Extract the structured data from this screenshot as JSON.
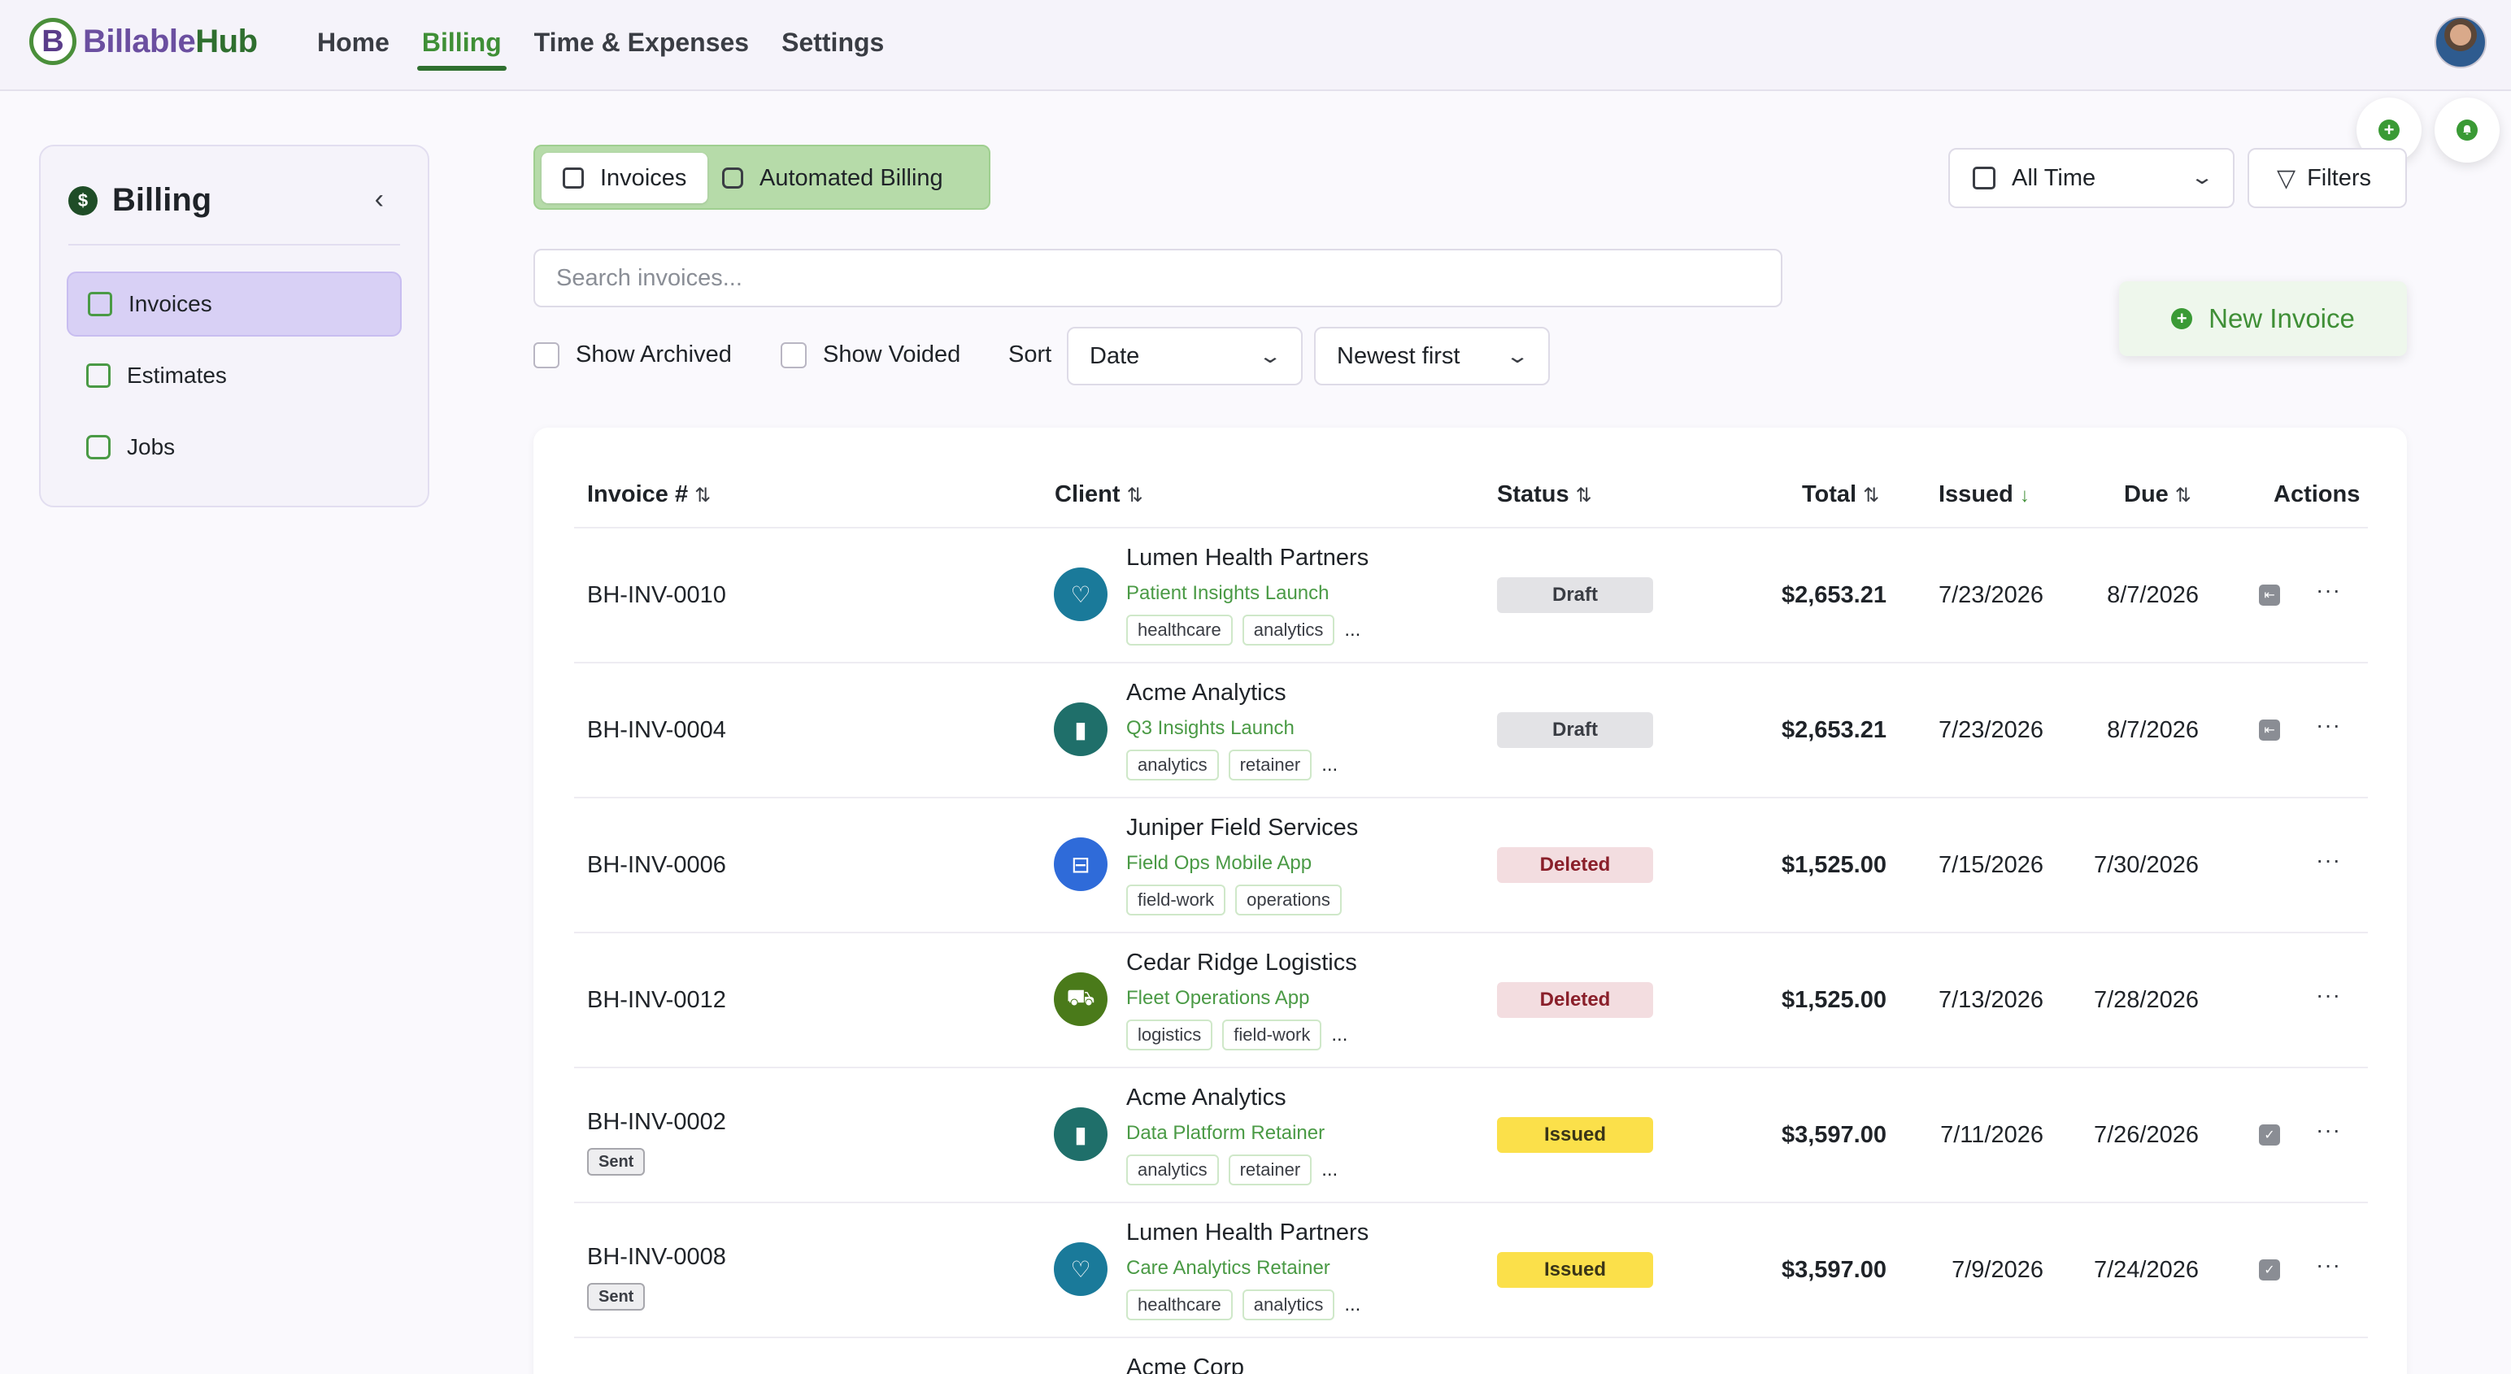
{
  "brand": {
    "mark": "B",
    "name_a": "Billable",
    "name_b": "Hub"
  },
  "nav": {
    "items": [
      "Home",
      "Billing",
      "Time & Expenses",
      "Settings"
    ],
    "active": "Billing"
  },
  "sidebar": {
    "title": "Billing",
    "coin": "$",
    "collapse": "‹",
    "items": [
      {
        "label": "Invoices",
        "icon": "invoice-icon",
        "active": true
      },
      {
        "label": "Estimates",
        "icon": "estimate-icon",
        "active": false
      },
      {
        "label": "Jobs",
        "icon": "briefcase-icon",
        "active": false
      }
    ]
  },
  "tabs": {
    "invoices": "Invoices",
    "automated": "Automated Billing"
  },
  "filters": {
    "range": "All Time",
    "filters_label": "Filters"
  },
  "new_invoice": {
    "label": "New Invoice",
    "plus": "+"
  },
  "search": {
    "placeholder": "Search invoices..."
  },
  "options": {
    "show_archived": "Show Archived",
    "show_voided": "Show Voided",
    "sort_label": "Sort",
    "sort_field": "Date",
    "sort_order": "Newest first"
  },
  "table": {
    "headers": {
      "invoice": "Invoice #",
      "client": "Client",
      "status": "Status",
      "total": "Total",
      "issued": "Issued",
      "due": "Due",
      "actions": "Actions"
    },
    "sort_icon": "⇅",
    "sort_desc_icon": "↓",
    "more": "···",
    "rows": [
      {
        "invoice": "BH-INV-0010",
        "badge": "",
        "client": "Lumen Health Partners",
        "project": "Patient Insights Launch",
        "tags": [
          "healthcare",
          "analytics"
        ],
        "more_tags": "...",
        "logo": "heart-icon",
        "logo_color": "#1a7a9a",
        "status": "Draft",
        "total": "$2,653.21",
        "issued": "7/23/2026",
        "due": "8/7/2026",
        "action": "send-icon"
      },
      {
        "invoice": "BH-INV-0004",
        "badge": "",
        "client": "Acme Analytics",
        "project": "Q3 Insights Launch",
        "tags": [
          "analytics",
          "retainer"
        ],
        "more_tags": "...",
        "logo": "bar-chart-icon",
        "logo_color": "#1f6f6a",
        "status": "Draft",
        "total": "$2,653.21",
        "issued": "7/23/2026",
        "due": "8/7/2026",
        "action": "send-icon"
      },
      {
        "invoice": "BH-INV-0006",
        "badge": "",
        "client": "Juniper Field Services",
        "project": "Field Ops Mobile App",
        "tags": [
          "field-work",
          "operations"
        ],
        "more_tags": "",
        "logo": "toolbox-icon",
        "logo_color": "#2f6bd9",
        "status": "Deleted",
        "total": "$1,525.00",
        "issued": "7/15/2026",
        "due": "7/30/2026",
        "action": ""
      },
      {
        "invoice": "BH-INV-0012",
        "badge": "",
        "client": "Cedar Ridge Logistics",
        "project": "Fleet Operations App",
        "tags": [
          "logistics",
          "field-work"
        ],
        "more_tags": "...",
        "logo": "truck-icon",
        "logo_color": "#4a7a1a",
        "status": "Deleted",
        "total": "$1,525.00",
        "issued": "7/13/2026",
        "due": "7/28/2026",
        "action": ""
      },
      {
        "invoice": "BH-INV-0002",
        "badge": "Sent",
        "client": "Acme Analytics",
        "project": "Data Platform Retainer",
        "tags": [
          "analytics",
          "retainer"
        ],
        "more_tags": "...",
        "logo": "bar-chart-icon",
        "logo_color": "#1f6f6a",
        "status": "Issued",
        "total": "$3,597.00",
        "issued": "7/11/2026",
        "due": "7/26/2026",
        "action": "check-icon"
      },
      {
        "invoice": "BH-INV-0008",
        "badge": "Sent",
        "client": "Lumen Health Partners",
        "project": "Care Analytics Retainer",
        "tags": [
          "healthcare",
          "analytics"
        ],
        "more_tags": "...",
        "logo": "heart-icon",
        "logo_color": "#1a7a9a",
        "status": "Issued",
        "total": "$3,597.00",
        "issued": "7/9/2026",
        "due": "7/24/2026",
        "action": "check-icon"
      },
      {
        "invoice": "",
        "badge": "",
        "client": "Acme Corp",
        "project": "",
        "tags": [],
        "more_tags": "",
        "logo": "building-icon",
        "logo_color": "#d93a3a",
        "status": "",
        "total": "",
        "issued": "",
        "due": "",
        "action": ""
      }
    ]
  }
}
